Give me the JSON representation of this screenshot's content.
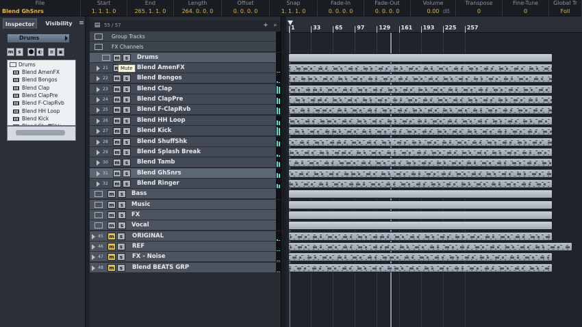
{
  "infoline": {
    "columns": [
      {
        "header": "File",
        "value": "Blend GhSnrs"
      },
      {
        "header": "Start",
        "value": "1. 1. 1. 0"
      },
      {
        "header": "End",
        "value": "265. 1. 1. 0"
      },
      {
        "header": "Length",
        "value": "264. 0. 0. 0"
      },
      {
        "header": "Offset",
        "value": "0. 0. 0. 0"
      },
      {
        "header": "Snap",
        "value": "1. 1. 1. 0"
      },
      {
        "header": "Fade-In",
        "value": "0. 0. 0. 0"
      },
      {
        "header": "Fade-Out",
        "value": "0. 0. 0. 0"
      },
      {
        "header": "Volume",
        "value": "0.00",
        "unit": "dB"
      },
      {
        "header": "Transpose",
        "value": "0"
      },
      {
        "header": "Fine-Tune",
        "value": "0"
      },
      {
        "header": "Global Tr",
        "value": "Foll"
      }
    ]
  },
  "inspector": {
    "tab_inspector": "Inspector",
    "tab_visibility": "Visibility",
    "menu_glyph": "≡",
    "track_name": "Drums",
    "buttons": {
      "m": "m",
      "s": "s"
    },
    "folder_label": "Drums",
    "items": [
      "Blend AmenFX",
      "Blend Bongos",
      "Blend Clap",
      "Blend ClapPre",
      "Blend F-ClapRvb",
      "Blend HH Loop",
      "Blend Kick",
      "Blend ShuffShk"
    ]
  },
  "tracklist": {
    "count_label": "55 / 57",
    "add_glyph": "+",
    "search_glyph": "⌕",
    "tooltip": "Mute",
    "tracks": [
      {
        "name": "Group Tracks",
        "type": "group"
      },
      {
        "name": "FX Channels",
        "type": "group"
      },
      {
        "name": "Drums",
        "type": "folder-top",
        "m": "m",
        "s": "s",
        "mute_on": false
      },
      {
        "name": "Blend AmenFX",
        "num": "21",
        "m": "m",
        "s": "s",
        "mute_on": false,
        "meter": 0.1
      },
      {
        "name": "Blend Bongos",
        "num": "22",
        "m": "m",
        "s": "s",
        "mute_on": false,
        "meter": 0.15
      },
      {
        "name": "Blend Clap",
        "num": "23",
        "m": "m",
        "s": "s",
        "mute_on": false,
        "meter": 0.85
      },
      {
        "name": "Blend ClapPre",
        "num": "24",
        "m": "m",
        "s": "s",
        "mute_on": false,
        "meter": 0.7
      },
      {
        "name": "Blend F-ClapRvb",
        "num": "25",
        "m": "m",
        "s": "s",
        "mute_on": false,
        "meter": 0.75
      },
      {
        "name": "Blend HH Loop",
        "num": "26",
        "m": "m",
        "s": "s",
        "mute_on": false,
        "meter": 0.55
      },
      {
        "name": "Blend Kick",
        "num": "27",
        "m": "m",
        "s": "s",
        "mute_on": false,
        "meter": 0.9
      },
      {
        "name": "Blend ShuffShk",
        "num": "28",
        "m": "m",
        "s": "s",
        "mute_on": false,
        "meter": 0.6
      },
      {
        "name": "Blend Splash Break",
        "num": "29",
        "m": "m",
        "s": "s",
        "mute_on": false,
        "meter": 0.2
      },
      {
        "name": "Blend Tamb",
        "num": "30",
        "m": "m",
        "s": "s",
        "mute_on": false,
        "meter": 0.65
      },
      {
        "name": "Blend GhSnrs",
        "num": "31",
        "m": "m",
        "s": "s",
        "mute_on": false,
        "meter": 0.5,
        "selected": true
      },
      {
        "name": "Blend Ringer",
        "num": "32",
        "m": "m",
        "s": "s",
        "mute_on": false,
        "meter": 0.45
      },
      {
        "name": "Bass",
        "type": "folder",
        "m": "m",
        "s": "s",
        "mute_on": false
      },
      {
        "name": "Music",
        "type": "folder",
        "m": "m",
        "s": "s",
        "mute_on": false
      },
      {
        "name": "FX",
        "type": "folder",
        "m": "m",
        "s": "s",
        "mute_on": false
      },
      {
        "name": "Vocal",
        "type": "folder",
        "m": "m",
        "s": "s",
        "mute_on": false
      },
      {
        "name": "ORIGINAL",
        "num": "45",
        "m": "m",
        "s": "s",
        "mute_on": true,
        "meter": 0.15
      },
      {
        "name": "REF",
        "num": "46",
        "m": "m",
        "s": "s",
        "mute_on": true,
        "meter": 0.1
      },
      {
        "name": "FX - Noise",
        "num": "47",
        "m": "m",
        "s": "s",
        "mute_on": true,
        "meter": 0.05
      },
      {
        "name": "Blend BEATS GRP",
        "num": "48",
        "m": "m",
        "s": "s",
        "mute_on": true,
        "meter": 0.1
      }
    ]
  },
  "ruler": {
    "bars": [
      "1",
      "33",
      "65",
      "97",
      "129",
      "161",
      "193",
      "225",
      "257"
    ]
  }
}
